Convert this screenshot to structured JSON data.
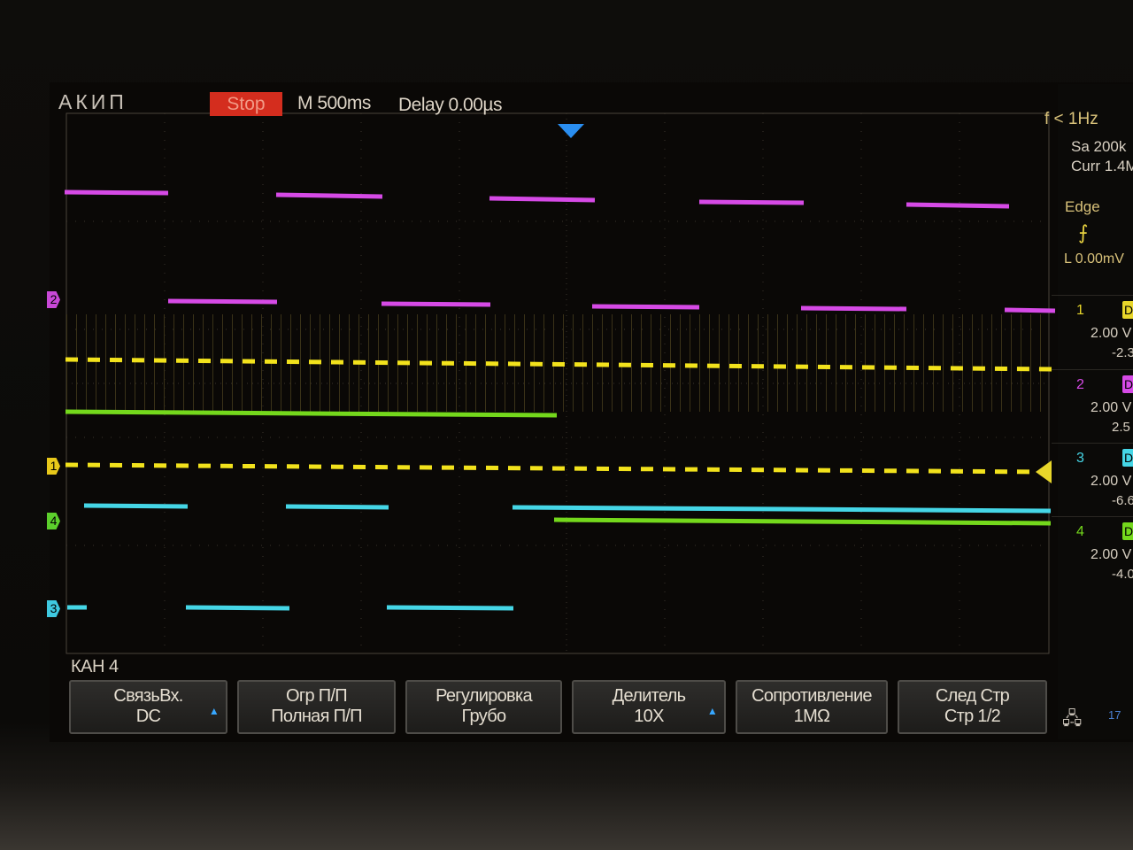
{
  "brand": "АКИП",
  "status": "Stop",
  "timebase": "M 500ms",
  "delay": "Delay 0.00µs",
  "freq": "f < 1Hz",
  "sample_rate": "Sa 200k",
  "memory": "Curr 1.4M",
  "trigger": {
    "type": "Edge",
    "edge_icon": "rising-edge-icon",
    "level": "L  0.00mV"
  },
  "channels": [
    {
      "num": "1",
      "color": "#e8d62a",
      "coupling": "D",
      "scale": "2.00 V",
      "offset": "-2.3"
    },
    {
      "num": "2",
      "color": "#d64ae6",
      "coupling": "D",
      "scale": "2.00 V",
      "offset": "2.5"
    },
    {
      "num": "3",
      "color": "#45d6e6",
      "coupling": "D",
      "scale": "2.00 V",
      "offset": "-6.6"
    },
    {
      "num": "4",
      "color": "#74d81c",
      "coupling": "D",
      "scale": "2.00 V",
      "offset": "-4.0"
    }
  ],
  "ground_markers": [
    {
      "label": "2",
      "color": "#c848d6"
    },
    {
      "label": "1",
      "color": "#e8c81a"
    },
    {
      "label": "4",
      "color": "#5ccf2c"
    },
    {
      "label": "3",
      "color": "#3fc9e0"
    }
  ],
  "menu_title": "КАН 4",
  "softkeys": [
    {
      "line1": "СвязьВх.",
      "line2": "DC",
      "has_arrow": true
    },
    {
      "line1": "Огр  П/П",
      "line2": "Полная П/П",
      "has_arrow": false
    },
    {
      "line1": "Регулировка",
      "line2": "Грубо",
      "has_arrow": false
    },
    {
      "line1": "Делитель",
      "line2": "10X",
      "has_arrow": true
    },
    {
      "line1": "Сопротивление",
      "line2": "1MΩ",
      "has_arrow": false
    },
    {
      "line1": "След  Стр",
      "line2": "Стр 1/2",
      "has_arrow": false
    }
  ],
  "status_bar": {
    "network_icon": "network-icon",
    "usb_count": "17"
  },
  "colors": {
    "ch1": "#f2e21c",
    "ch2": "#d64ae6",
    "ch3": "#45d6e6",
    "ch4": "#74d81c",
    "stop_bg": "#d42d1e",
    "trigger_marker": "#2a8ef0"
  }
}
